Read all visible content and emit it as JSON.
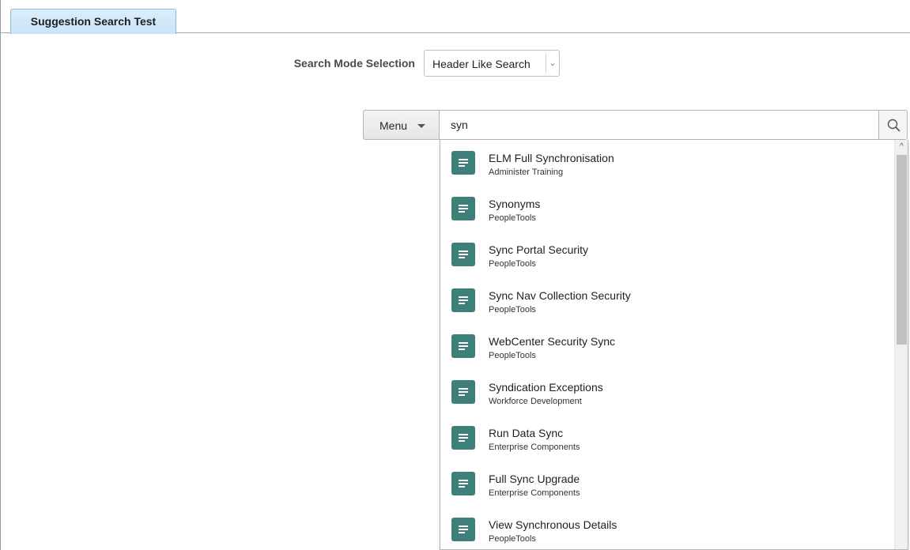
{
  "tabs": [
    {
      "label": "Suggestion Search Test",
      "active": true
    }
  ],
  "search_mode": {
    "label": "Search Mode Selection",
    "selected": "Header Like Search",
    "chevron": "⌄"
  },
  "search": {
    "menu_label": "Menu",
    "query": "syn",
    "icon": "search-icon"
  },
  "suggestions": [
    {
      "title": "ELM Full Synchronisation",
      "subtitle": "Administer Training"
    },
    {
      "title": "Synonyms",
      "subtitle": "PeopleTools"
    },
    {
      "title": "Sync Portal Security",
      "subtitle": "PeopleTools"
    },
    {
      "title": "Sync Nav Collection Security",
      "subtitle": "PeopleTools"
    },
    {
      "title": "WebCenter Security Sync",
      "subtitle": "PeopleTools"
    },
    {
      "title": "Syndication Exceptions",
      "subtitle": "Workforce Development"
    },
    {
      "title": "Run Data Sync",
      "subtitle": "Enterprise Components"
    },
    {
      "title": "Full Sync Upgrade",
      "subtitle": "Enterprise Components"
    },
    {
      "title": "View Synchronous Details",
      "subtitle": "PeopleTools"
    }
  ],
  "colors": {
    "item_icon": "#3f7f7a",
    "tab_active": "#c9e4f7"
  },
  "scrollbar": {
    "up_arrow": "^"
  }
}
